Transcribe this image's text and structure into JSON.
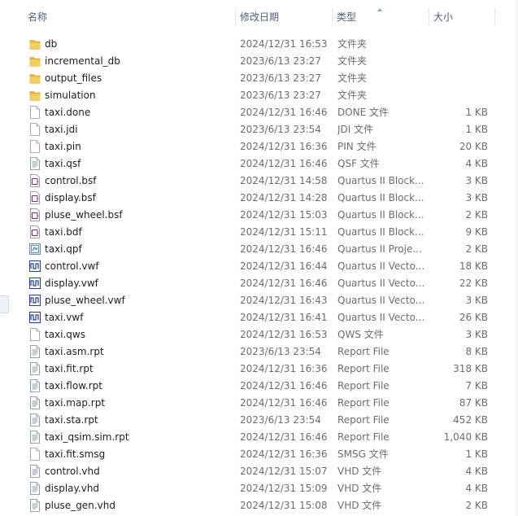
{
  "columns": {
    "name": "名称",
    "date": "修改日期",
    "type": "类型",
    "size": "大小"
  },
  "icons": {
    "folder": "folder-icon",
    "blank": "blank-file-icon",
    "text": "text-file-icon",
    "schematic": "schematic-file-icon",
    "project": "project-file-icon",
    "waveform": "waveform-file-icon"
  },
  "colors": {
    "folder": "#e8b93a",
    "schematic": "#8a2b8f",
    "waveform": "#1f3d9c",
    "header_text": "#4c607a"
  },
  "files": [
    {
      "name": "db",
      "date": "2024/12/31 16:53",
      "type": "文件夹",
      "size": "",
      "icon": "folder"
    },
    {
      "name": "incremental_db",
      "date": "2023/6/13 23:27",
      "type": "文件夹",
      "size": "",
      "icon": "folder"
    },
    {
      "name": "output_files",
      "date": "2023/6/13 23:27",
      "type": "文件夹",
      "size": "",
      "icon": "folder"
    },
    {
      "name": "simulation",
      "date": "2023/6/13 23:27",
      "type": "文件夹",
      "size": "",
      "icon": "folder"
    },
    {
      "name": "taxi.done",
      "date": "2024/12/31 16:46",
      "type": "DONE 文件",
      "size": "1 KB",
      "icon": "blank"
    },
    {
      "name": "taxi.jdi",
      "date": "2023/6/13 23:54",
      "type": "JDI 文件",
      "size": "1 KB",
      "icon": "blank"
    },
    {
      "name": "taxi.pin",
      "date": "2024/12/31 16:36",
      "type": "PIN 文件",
      "size": "20 KB",
      "icon": "blank"
    },
    {
      "name": "taxi.qsf",
      "date": "2024/12/31 16:46",
      "type": "QSF 文件",
      "size": "4 KB",
      "icon": "text"
    },
    {
      "name": "control.bsf",
      "date": "2024/12/31 14:58",
      "type": "Quartus II Block...",
      "size": "3 KB",
      "icon": "schematic"
    },
    {
      "name": "display.bsf",
      "date": "2024/12/31 14:28",
      "type": "Quartus II Block...",
      "size": "3 KB",
      "icon": "schematic"
    },
    {
      "name": "pluse_wheel.bsf",
      "date": "2024/12/31 15:03",
      "type": "Quartus II Block...",
      "size": "2 KB",
      "icon": "schematic"
    },
    {
      "name": "taxi.bdf",
      "date": "2024/12/31 15:11",
      "type": "Quartus II Block...",
      "size": "9 KB",
      "icon": "schematic"
    },
    {
      "name": "taxi.qpf",
      "date": "2024/12/31 16:46",
      "type": "Quartus II Proje...",
      "size": "2 KB",
      "icon": "project"
    },
    {
      "name": "control.vwf",
      "date": "2024/12/31 16:44",
      "type": "Quartus II Vecto...",
      "size": "18 KB",
      "icon": "waveform"
    },
    {
      "name": "display.vwf",
      "date": "2024/12/31 16:46",
      "type": "Quartus II Vecto...",
      "size": "22 KB",
      "icon": "waveform"
    },
    {
      "name": "pluse_wheel.vwf",
      "date": "2024/12/31 16:43",
      "type": "Quartus II Vecto...",
      "size": "3 KB",
      "icon": "waveform"
    },
    {
      "name": "taxi.vwf",
      "date": "2024/12/31 16:41",
      "type": "Quartus II Vecto...",
      "size": "26 KB",
      "icon": "waveform"
    },
    {
      "name": "taxi.qws",
      "date": "2024/12/31 16:53",
      "type": "QWS 文件",
      "size": "3 KB",
      "icon": "blank"
    },
    {
      "name": "taxi.asm.rpt",
      "date": "2023/6/13 23:54",
      "type": "Report File",
      "size": "8 KB",
      "icon": "text"
    },
    {
      "name": "taxi.fit.rpt",
      "date": "2024/12/31 16:36",
      "type": "Report File",
      "size": "318 KB",
      "icon": "text"
    },
    {
      "name": "taxi.flow.rpt",
      "date": "2024/12/31 16:46",
      "type": "Report File",
      "size": "7 KB",
      "icon": "text"
    },
    {
      "name": "taxi.map.rpt",
      "date": "2024/12/31 16:46",
      "type": "Report File",
      "size": "87 KB",
      "icon": "text"
    },
    {
      "name": "taxi.sta.rpt",
      "date": "2023/6/13 23:54",
      "type": "Report File",
      "size": "452 KB",
      "icon": "text"
    },
    {
      "name": "taxi_qsim.sim.rpt",
      "date": "2024/12/31 16:46",
      "type": "Report File",
      "size": "1,040 KB",
      "icon": "text"
    },
    {
      "name": "taxi.fit.smsg",
      "date": "2024/12/31 16:36",
      "type": "SMSG 文件",
      "size": "1 KB",
      "icon": "blank"
    },
    {
      "name": "control.vhd",
      "date": "2024/12/31 15:07",
      "type": "VHD 文件",
      "size": "4 KB",
      "icon": "text"
    },
    {
      "name": "display.vhd",
      "date": "2024/12/31 15:09",
      "type": "VHD 文件",
      "size": "4 KB",
      "icon": "text"
    },
    {
      "name": "pluse_gen.vhd",
      "date": "2024/12/31 15:08",
      "type": "VHD 文件",
      "size": "2 KB",
      "icon": "text"
    }
  ]
}
